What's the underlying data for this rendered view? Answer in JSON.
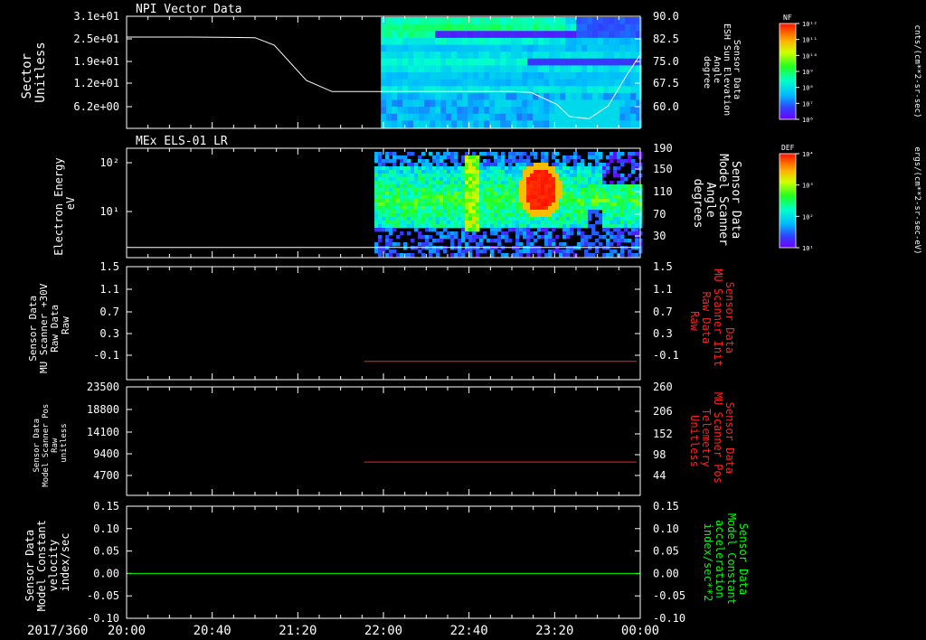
{
  "time_axis": {
    "date_label": "2017/360",
    "tick_labels": [
      "20:00",
      "20:40",
      "21:20",
      "22:00",
      "22:40",
      "23:20",
      "00:00"
    ],
    "start_hour": 20.0,
    "end_hour": 24.0
  },
  "colors": {
    "panel_frame": "#ffffff",
    "red_trace": "#ff2020",
    "green_trace": "#00ff00",
    "background": "#000000"
  },
  "chart_data": [
    {
      "id": "npi",
      "type": "heatmap",
      "title": "NPI Vector Data",
      "ylabel": [
        "Sector",
        "Unitless"
      ],
      "yticks_left": [
        "3.1e+01",
        "2.5e+01",
        "1.9e+01",
        "1.2e+01",
        "6.2e+00"
      ],
      "yticks_right": [
        "90.0",
        "82.5",
        "75.0",
        "67.5",
        "60.0"
      ],
      "ylim_right": [
        55.0,
        90.0
      ],
      "right_label": [
        "Sensor Data",
        "ESH Sun Elevation",
        "Angle",
        "degree"
      ],
      "colorbar": {
        "label": "NF",
        "unit": "cnts/(cm**2-sr-sec)",
        "ticks": [
          "10¹²",
          "10¹¹",
          "10¹⁰",
          "10⁹",
          "10⁸",
          "10⁷",
          "10⁶"
        ]
      },
      "data_start_hour": 21.98,
      "line": {
        "name": "ESH Sun Elevation Angle",
        "x": [
          20.0,
          20.5,
          21.0,
          21.15,
          21.4,
          21.6,
          22.0,
          22.5,
          23.0,
          23.15,
          23.35,
          23.45,
          23.6,
          23.75,
          23.9,
          24.0
        ],
        "y": [
          83.5,
          83.5,
          83.3,
          81.0,
          70.0,
          66.5,
          66.5,
          66.5,
          66.5,
          66.2,
          62.5,
          58.7,
          58.0,
          62.0,
          72.0,
          78.0
        ]
      }
    },
    {
      "id": "els",
      "type": "heatmap",
      "title": "MEx ELS-01 LR",
      "ylabel": [
        "Electron Energy",
        "eV"
      ],
      "yticks_left": [
        "10²",
        "10¹"
      ],
      "yticks_right": [
        "190",
        "150",
        "110",
        "70",
        "30"
      ],
      "ylim_right": [
        0,
        190
      ],
      "right_label": [
        "Sensor Data",
        "Model Scanner",
        "Angle",
        "degrees"
      ],
      "colorbar": {
        "label": "DEF",
        "unit": "ergs/(cm**2-sr-sec-eV)",
        "ticks": [
          "10⁴",
          "10³",
          "10²",
          "10¹"
        ]
      },
      "data_start_hour": 21.93,
      "line": {
        "name": "Model Scanner Angle",
        "x": [
          20.0,
          24.0
        ],
        "y": [
          2,
          2
        ]
      }
    },
    {
      "id": "mu_raw",
      "type": "line",
      "ylabel": [
        "Sensor Data",
        "MU Scanner +30V",
        "Raw Data",
        "Raw"
      ],
      "yticks_left": [
        "1.5",
        "1.1",
        "0.7",
        "0.3",
        "-0.1"
      ],
      "yticks_right": [
        "1.5",
        "1.1",
        "0.7",
        "0.3",
        "-0.1"
      ],
      "ylim": [
        -0.35,
        1.5
      ],
      "right_label": [
        "Sensor Data",
        "MU Scanner Init",
        "Raw Data",
        "Raw"
      ],
      "right_label_color": "#ff2020",
      "series": [
        {
          "name": "MU Scanner Init Raw Data",
          "x": [
            21.85,
            24.0
          ],
          "y": [
            -0.05,
            -0.05
          ]
        }
      ]
    },
    {
      "id": "scanner_pos",
      "type": "line",
      "ylabel": [
        "Sensor Data",
        "Model Scanner Pos",
        "Raw",
        "unitless"
      ],
      "yticks_left": [
        "23500",
        "18800",
        "14100",
        "9400",
        "4700"
      ],
      "yticks_right": [
        "260",
        "206",
        "152",
        "98",
        "44"
      ],
      "ylim_right": [
        0,
        260
      ],
      "right_label": [
        "Sensor Data",
        "MU Scanner Pos",
        "Telemetry",
        "Unitless"
      ],
      "right_label_color": "#ff2020",
      "series": [
        {
          "name": "MU Scanner Pos Telemetry",
          "x": [
            21.85,
            24.0
          ],
          "y": [
            80,
            80
          ]
        }
      ]
    },
    {
      "id": "constant_velocity",
      "type": "line",
      "ylabel": [
        "Sensor Data",
        "Model Constant",
        "velocity",
        "index/sec"
      ],
      "yticks_left": [
        "0.15",
        "0.10",
        "0.05",
        "0.00",
        "-0.05",
        "-0.10"
      ],
      "yticks_right": [
        "0.15",
        "0.10",
        "0.05",
        "0.00",
        "-0.05",
        "-0.10"
      ],
      "ylim": [
        -0.1,
        0.15
      ],
      "right_label": [
        "Sensor Data",
        "Model Constant",
        "acceleration",
        "index/sec**2"
      ],
      "right_label_color": "#00ff00",
      "series": [
        {
          "name": "Model Constant acceleration",
          "x": [
            20.0,
            24.0
          ],
          "y": [
            0.0,
            0.0
          ]
        }
      ]
    }
  ]
}
